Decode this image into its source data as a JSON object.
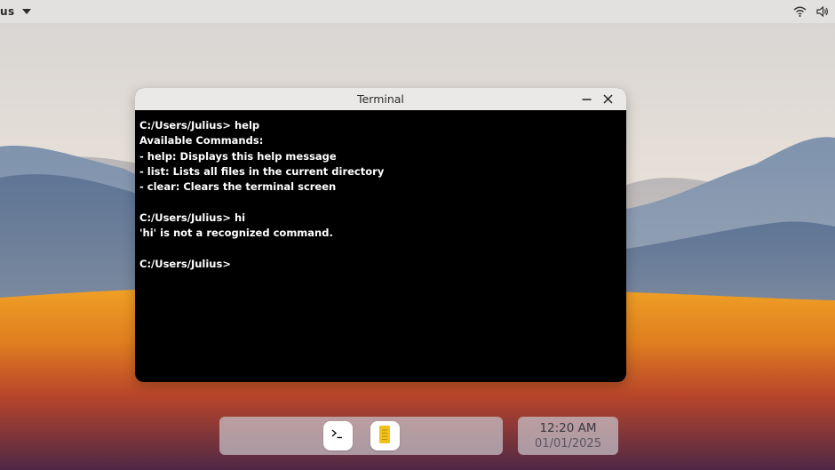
{
  "topbar": {
    "title": "us",
    "icons": [
      "chevron-down-icon",
      "wifi-icon",
      "volume-icon"
    ]
  },
  "window": {
    "title": "Terminal",
    "controls": [
      "minimize-icon",
      "close-icon"
    ]
  },
  "terminal": {
    "lines": [
      "C:/Users/Julius> help",
      "Available Commands:",
      "- help: Displays this help message",
      "- list: Lists all files in the current directory",
      "- clear: Clears the terminal screen",
      "",
      "C:/Users/Julius> hi",
      "'hi' is not a recognized command.",
      ""
    ],
    "prompt": "C:/Users/Julius>",
    "input_value": ""
  },
  "dock": {
    "apps": [
      {
        "icon": "terminal-icon"
      },
      {
        "icon": "notes-icon"
      }
    ]
  },
  "clock": {
    "time": "12:20 AM",
    "date": "01/01/2025"
  },
  "colors": {
    "terminal_bg": "#000000",
    "terminal_fg": "#ffffff",
    "notes_icon": "#f2c21b"
  }
}
